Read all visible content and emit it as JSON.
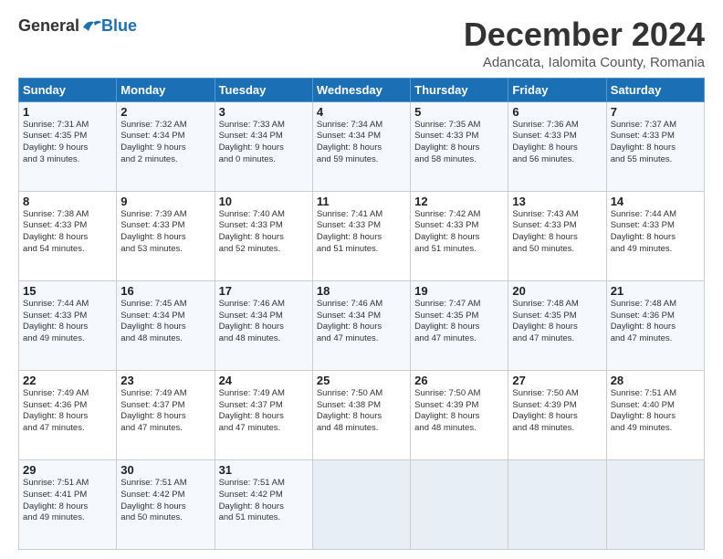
{
  "logo": {
    "general": "General",
    "blue": "Blue"
  },
  "title": "December 2024",
  "subtitle": "Adancata, Ialomita County, Romania",
  "days_header": [
    "Sunday",
    "Monday",
    "Tuesday",
    "Wednesday",
    "Thursday",
    "Friday",
    "Saturday"
  ],
  "weeks": [
    [
      {
        "day": "1",
        "info": "Sunrise: 7:31 AM\nSunset: 4:35 PM\nDaylight: 9 hours\nand 3 minutes."
      },
      {
        "day": "2",
        "info": "Sunrise: 7:32 AM\nSunset: 4:34 PM\nDaylight: 9 hours\nand 2 minutes."
      },
      {
        "day": "3",
        "info": "Sunrise: 7:33 AM\nSunset: 4:34 PM\nDaylight: 9 hours\nand 0 minutes."
      },
      {
        "day": "4",
        "info": "Sunrise: 7:34 AM\nSunset: 4:34 PM\nDaylight: 8 hours\nand 59 minutes."
      },
      {
        "day": "5",
        "info": "Sunrise: 7:35 AM\nSunset: 4:33 PM\nDaylight: 8 hours\nand 58 minutes."
      },
      {
        "day": "6",
        "info": "Sunrise: 7:36 AM\nSunset: 4:33 PM\nDaylight: 8 hours\nand 56 minutes."
      },
      {
        "day": "7",
        "info": "Sunrise: 7:37 AM\nSunset: 4:33 PM\nDaylight: 8 hours\nand 55 minutes."
      }
    ],
    [
      {
        "day": "8",
        "info": "Sunrise: 7:38 AM\nSunset: 4:33 PM\nDaylight: 8 hours\nand 54 minutes."
      },
      {
        "day": "9",
        "info": "Sunrise: 7:39 AM\nSunset: 4:33 PM\nDaylight: 8 hours\nand 53 minutes."
      },
      {
        "day": "10",
        "info": "Sunrise: 7:40 AM\nSunset: 4:33 PM\nDaylight: 8 hours\nand 52 minutes."
      },
      {
        "day": "11",
        "info": "Sunrise: 7:41 AM\nSunset: 4:33 PM\nDaylight: 8 hours\nand 51 minutes."
      },
      {
        "day": "12",
        "info": "Sunrise: 7:42 AM\nSunset: 4:33 PM\nDaylight: 8 hours\nand 51 minutes."
      },
      {
        "day": "13",
        "info": "Sunrise: 7:43 AM\nSunset: 4:33 PM\nDaylight: 8 hours\nand 50 minutes."
      },
      {
        "day": "14",
        "info": "Sunrise: 7:44 AM\nSunset: 4:33 PM\nDaylight: 8 hours\nand 49 minutes."
      }
    ],
    [
      {
        "day": "15",
        "info": "Sunrise: 7:44 AM\nSunset: 4:33 PM\nDaylight: 8 hours\nand 49 minutes."
      },
      {
        "day": "16",
        "info": "Sunrise: 7:45 AM\nSunset: 4:34 PM\nDaylight: 8 hours\nand 48 minutes."
      },
      {
        "day": "17",
        "info": "Sunrise: 7:46 AM\nSunset: 4:34 PM\nDaylight: 8 hours\nand 48 minutes."
      },
      {
        "day": "18",
        "info": "Sunrise: 7:46 AM\nSunset: 4:34 PM\nDaylight: 8 hours\nand 47 minutes."
      },
      {
        "day": "19",
        "info": "Sunrise: 7:47 AM\nSunset: 4:35 PM\nDaylight: 8 hours\nand 47 minutes."
      },
      {
        "day": "20",
        "info": "Sunrise: 7:48 AM\nSunset: 4:35 PM\nDaylight: 8 hours\nand 47 minutes."
      },
      {
        "day": "21",
        "info": "Sunrise: 7:48 AM\nSunset: 4:36 PM\nDaylight: 8 hours\nand 47 minutes."
      }
    ],
    [
      {
        "day": "22",
        "info": "Sunrise: 7:49 AM\nSunset: 4:36 PM\nDaylight: 8 hours\nand 47 minutes."
      },
      {
        "day": "23",
        "info": "Sunrise: 7:49 AM\nSunset: 4:37 PM\nDaylight: 8 hours\nand 47 minutes."
      },
      {
        "day": "24",
        "info": "Sunrise: 7:49 AM\nSunset: 4:37 PM\nDaylight: 8 hours\nand 47 minutes."
      },
      {
        "day": "25",
        "info": "Sunrise: 7:50 AM\nSunset: 4:38 PM\nDaylight: 8 hours\nand 48 minutes."
      },
      {
        "day": "26",
        "info": "Sunrise: 7:50 AM\nSunset: 4:39 PM\nDaylight: 8 hours\nand 48 minutes."
      },
      {
        "day": "27",
        "info": "Sunrise: 7:50 AM\nSunset: 4:39 PM\nDaylight: 8 hours\nand 48 minutes."
      },
      {
        "day": "28",
        "info": "Sunrise: 7:51 AM\nSunset: 4:40 PM\nDaylight: 8 hours\nand 49 minutes."
      }
    ],
    [
      {
        "day": "29",
        "info": "Sunrise: 7:51 AM\nSunset: 4:41 PM\nDaylight: 8 hours\nand 49 minutes."
      },
      {
        "day": "30",
        "info": "Sunrise: 7:51 AM\nSunset: 4:42 PM\nDaylight: 8 hours\nand 50 minutes."
      },
      {
        "day": "31",
        "info": "Sunrise: 7:51 AM\nSunset: 4:42 PM\nDaylight: 8 hours\nand 51 minutes."
      },
      {
        "day": "",
        "info": ""
      },
      {
        "day": "",
        "info": ""
      },
      {
        "day": "",
        "info": ""
      },
      {
        "day": "",
        "info": ""
      }
    ]
  ]
}
